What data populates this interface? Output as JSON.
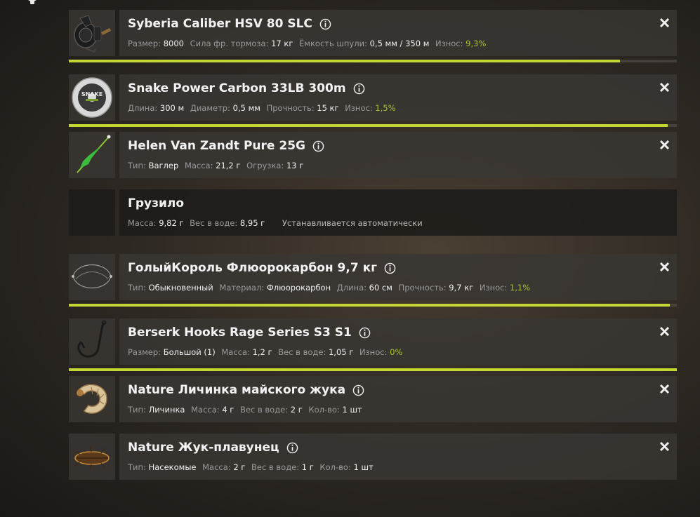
{
  "colors": {
    "accent": "#c3d633",
    "wear_text": "#a8c432"
  },
  "items": [
    {
      "title": "Syberia Caliber HSV 80 SLC",
      "thumb_icon": "reel-icon",
      "stats": [
        {
          "label": "Размер:",
          "value": "8000"
        },
        {
          "label": "Сила фр. тормоза:",
          "value": "17 кг"
        },
        {
          "label": "Ёмкость шпули:",
          "value": "0,5 мм / 350 м"
        }
      ],
      "wear_label": "Износ:",
      "wear_value": "9,3%",
      "durability": 0.907
    },
    {
      "title": "Snake Power Carbon 33LB 300m",
      "thumb_icon": "line-spool-icon",
      "stats": [
        {
          "label": "Длина:",
          "value": "300 м"
        },
        {
          "label": "Диаметр:",
          "value": "0,5 мм"
        },
        {
          "label": "Прочность:",
          "value": "15 кг"
        }
      ],
      "wear_label": "Износ:",
      "wear_value": "1,5%",
      "durability": 0.985
    },
    {
      "title": "Helen Van Zandt Pure 25G",
      "thumb_icon": "float-icon",
      "stats": [
        {
          "label": "Тип:",
          "value": "Ваглер"
        },
        {
          "label": "Масса:",
          "value": "21,2 г"
        },
        {
          "label": "Огрузка:",
          "value": "13 г"
        }
      ]
    },
    {
      "title": "Грузило",
      "stats": [
        {
          "label": "Масса:",
          "value": "9,82 г"
        },
        {
          "label": "Вес в воде:",
          "value": "8,95 г"
        }
      ],
      "note": "Устанавливается автоматически"
    },
    {
      "title": "ГолыйКороль Флюорокарбон 9,7 кг",
      "thumb_icon": "leader-icon",
      "stats": [
        {
          "label": "Тип:",
          "value": "Обыкновенный"
        },
        {
          "label": "Материал:",
          "value": "Флюорокарбон"
        },
        {
          "label": "Длина:",
          "value": "60 см"
        },
        {
          "label": "Прочность:",
          "value": "9,7 кг"
        }
      ],
      "wear_label": "Износ:",
      "wear_value": "1,1%",
      "durability": 0.989
    },
    {
      "title": "Berserk Hooks Rage Series S3 S1",
      "thumb_icon": "hook-icon",
      "stats": [
        {
          "label": "Размер:",
          "value": "Большой (1)"
        },
        {
          "label": "Масса:",
          "value": "1,2 г"
        },
        {
          "label": "Вес в воде:",
          "value": "1,05 г"
        }
      ],
      "wear_label": "Износ:",
      "wear_value": "0%",
      "durability": 1.0
    },
    {
      "title": "Nature Личинка майского жука",
      "thumb_icon": "grub-icon",
      "stats": [
        {
          "label": "Тип:",
          "value": "Личинка"
        },
        {
          "label": "Масса:",
          "value": "4 г"
        },
        {
          "label": "Вес в воде:",
          "value": "2 г"
        },
        {
          "label": "Кол-во:",
          "value": "1 шт"
        }
      ]
    },
    {
      "title": "Nature Жук-плавунец",
      "thumb_icon": "beetle-icon",
      "stats": [
        {
          "label": "Тип:",
          "value": "Насекомые"
        },
        {
          "label": "Масса:",
          "value": "2 г"
        },
        {
          "label": "Вес в воде:",
          "value": "1 г"
        },
        {
          "label": "Кол-во:",
          "value": "1 шт"
        }
      ]
    }
  ]
}
